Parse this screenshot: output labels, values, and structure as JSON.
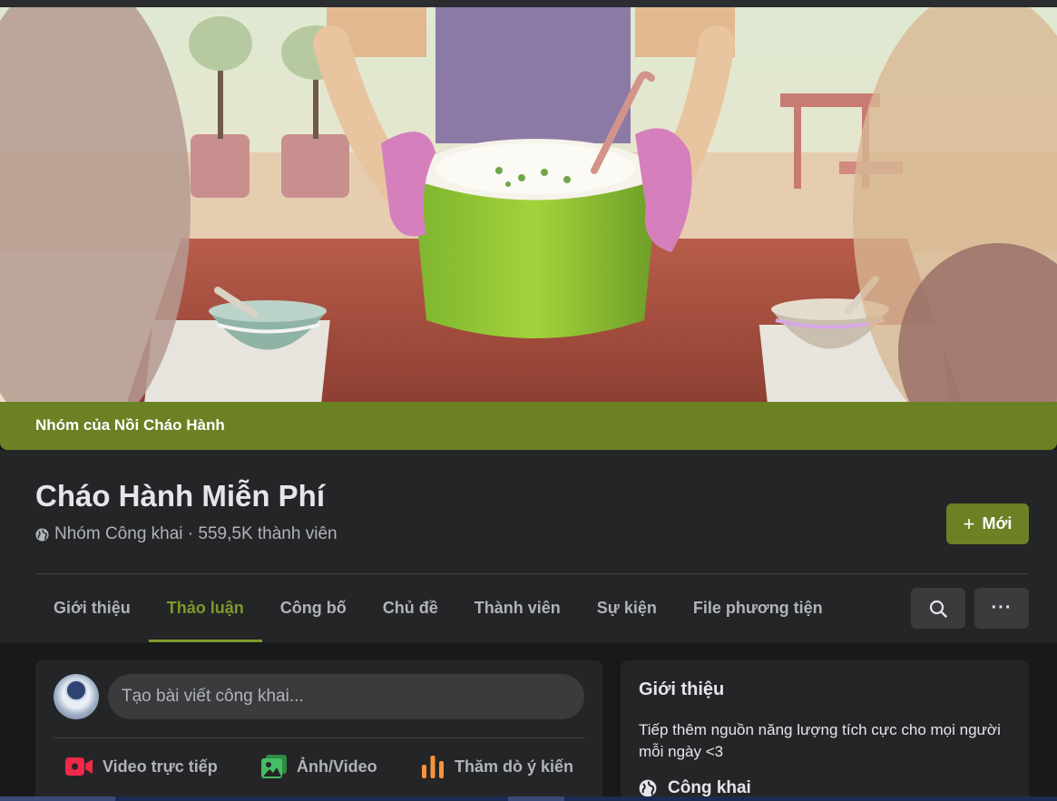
{
  "group": {
    "band_label": "Nhóm của Nồi Cháo Hành",
    "name": "Cháo Hành Miễn Phí",
    "privacy_meta": "Nhóm Công khai · 559,5K thành viên",
    "invite_label": "Mới",
    "accent_color": "#6b8124"
  },
  "tabs": [
    {
      "label": "Giới thiệu",
      "active": false
    },
    {
      "label": "Thảo luận",
      "active": true
    },
    {
      "label": "Công bố",
      "active": false
    },
    {
      "label": "Chủ đề",
      "active": false
    },
    {
      "label": "Thành viên",
      "active": false
    },
    {
      "label": "Sự kiện",
      "active": false
    },
    {
      "label": "File phương tiện",
      "active": false
    }
  ],
  "toolbar": {
    "search_icon": "search-icon",
    "more_icon": "more-horizontal-icon",
    "more_label": "···"
  },
  "composer": {
    "placeholder": "Tạo bài viết công khai...",
    "actions": [
      {
        "label": "Video trực tiếp",
        "icon": "live-video-icon",
        "color": "#f02849"
      },
      {
        "label": "Ảnh/Video",
        "icon": "photo-video-icon",
        "color": "#45bd62"
      },
      {
        "label": "Thăm dò ý kiến",
        "icon": "poll-icon",
        "color": "#f7923b"
      }
    ]
  },
  "about": {
    "heading": "Giới thiệu",
    "description": "Tiếp thêm nguồn năng lượng tích cực cho mọi người mỗi ngày <3",
    "privacy_label": "Công khai"
  }
}
